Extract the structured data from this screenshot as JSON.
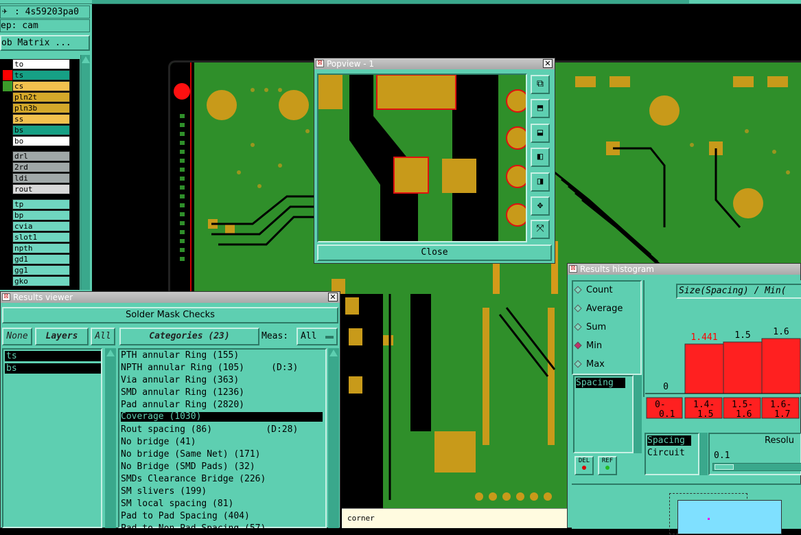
{
  "left_panel": {
    "job": ": 4s59203pa0",
    "step": "ep: cam",
    "matrix_button": "ob Matrix ...",
    "layers": [
      {
        "name": "to",
        "color": "#ffffff",
        "swatch": "#000000"
      },
      {
        "name": "ts",
        "color": "#16a085",
        "swatch": "#ff0000"
      },
      {
        "name": "cs",
        "color": "#f2c14e",
        "swatch": "#3c9a2a"
      },
      {
        "name": "pln2t",
        "color": "#d4a82a",
        "swatch": "#000000"
      },
      {
        "name": "pln3b",
        "color": "#d4a82a",
        "swatch": "#000000"
      },
      {
        "name": "ss",
        "color": "#f2c14e",
        "swatch": "#000000"
      },
      {
        "name": "bs",
        "color": "#16a085",
        "swatch": "#000000"
      },
      {
        "name": "bo",
        "color": "#ffffff",
        "swatch": "#000000"
      },
      {
        "name": "drl",
        "color": "#a0a8a8",
        "swatch": "#000000"
      },
      {
        "name": "2rd",
        "color": "#a0a8a8",
        "swatch": "#000000"
      },
      {
        "name": "ldi",
        "color": "#a0a8a8",
        "swatch": "#000000"
      },
      {
        "name": "rout",
        "color": "#d8d8d8",
        "swatch": "#000000"
      },
      {
        "name": "tp",
        "color": "#6fd6c0",
        "swatch": "#000000"
      },
      {
        "name": "bp",
        "color": "#6fd6c0",
        "swatch": "#000000"
      },
      {
        "name": "cvia",
        "color": "#6fd6c0",
        "swatch": "#000000"
      },
      {
        "name": "slot1",
        "color": "#6fd6c0",
        "swatch": "#000000"
      },
      {
        "name": "npth",
        "color": "#6fd6c0",
        "swatch": "#000000"
      },
      {
        "name": "gd1",
        "color": "#6fd6c0",
        "swatch": "#000000"
      },
      {
        "name": "gg1",
        "color": "#6fd6c0",
        "swatch": "#000000"
      },
      {
        "name": "gko",
        "color": "#6fd6c0",
        "swatch": "#000000"
      }
    ]
  },
  "popview": {
    "title": "Popview - 1",
    "close_label": "Close"
  },
  "results_viewer": {
    "title": "Results viewer",
    "header": "Solder Mask Checks",
    "none_label": "None",
    "layers_label": "Layers",
    "all_label": "All",
    "categories_label": "Categories (23)",
    "meas_label": "Meas:",
    "meas_value": "All",
    "layers": [
      "ts",
      "bs"
    ],
    "categories": [
      "PTH annular Ring (155)",
      "NPTH annular Ring (105)     (D:3)",
      "Via annular Ring (363)",
      "SMD annular Ring (1236)",
      "Pad annular Ring (2820)",
      "Coverage (1030)",
      "Rout spacing (86)          (D:28)",
      "No bridge (41)",
      "No bridge (Same Net) (171)",
      "No Bridge (SMD Pads) (32)",
      "SMDs Clearance Bridge (226)",
      "SM slivers (199)",
      "SM local spacing (81)",
      "Pad to Pad Spacing (404)",
      "Pad to Non Pad Spacing (57)"
    ],
    "selected_category": 5
  },
  "status_text": "corner",
  "histogram": {
    "title": "Results histogram",
    "options": [
      "Count",
      "Average",
      "Sum",
      "Min",
      "Max"
    ],
    "selected_option": "Min",
    "chart_title": "Size(Spacing) / Min(",
    "list_items": [
      "Spacing"
    ],
    "del_label": "DEL",
    "ref_label": "REF",
    "bottom_list": [
      "Spacing",
      "Circuit"
    ],
    "resolution_label": "Resolu",
    "resolution_value": "0.1",
    "chart_data": {
      "type": "bar",
      "categories": [
        "0-0.1",
        "1.4-1.5",
        "1.5-1.6",
        "1.6-1.7"
      ],
      "values": [
        0,
        1.441,
        1.5,
        1.6
      ],
      "value_labels": [
        "0",
        "1.441",
        "1.5",
        "1.6"
      ],
      "title": "Size(Spacing) / Min(",
      "colors": {
        "bar": "#ff2020",
        "first_label": "#ff0000"
      }
    }
  }
}
